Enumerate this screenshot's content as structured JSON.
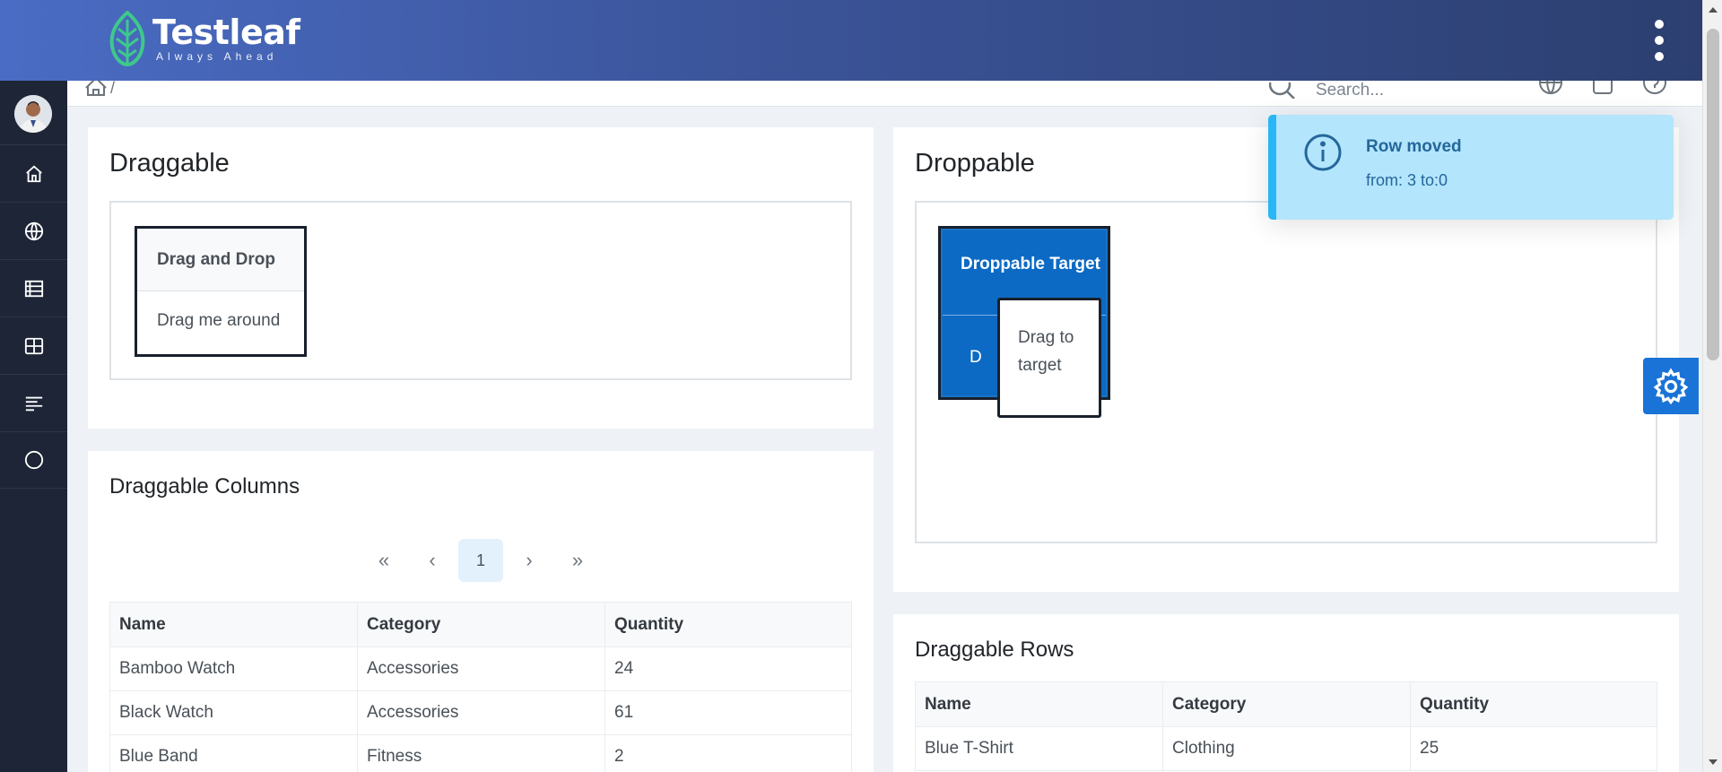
{
  "header": {
    "logo_name": "Testleaf",
    "logo_tagline": "Always Ahead"
  },
  "breadcrumb": {
    "separator": "/"
  },
  "search": {
    "placeholder": "Search..."
  },
  "sidebar": {
    "items": [
      {
        "icon": "home-icon"
      },
      {
        "icon": "globe-icon"
      },
      {
        "icon": "table-list-icon"
      },
      {
        "icon": "grid-icon"
      },
      {
        "icon": "align-left-icon"
      },
      {
        "icon": "circle-icon"
      }
    ]
  },
  "draggable": {
    "title": "Draggable",
    "panel_header": "Drag and Drop",
    "panel_body": "Drag me around"
  },
  "droppable": {
    "title": "Droppable",
    "target_header": "Droppable Target",
    "target_body": "D",
    "drag_item": "Drag to target"
  },
  "draggable_columns": {
    "title": "Draggable Columns",
    "paginator": {
      "first": "«",
      "prev": "‹",
      "page": "1",
      "next": "›",
      "last": "»"
    },
    "columns": [
      "Name",
      "Category",
      "Quantity"
    ],
    "rows": [
      [
        "Bamboo Watch",
        "Accessories",
        "24"
      ],
      [
        "Black Watch",
        "Accessories",
        "61"
      ],
      [
        "Blue Band",
        "Fitness",
        "2"
      ]
    ]
  },
  "draggable_rows": {
    "title": "Draggable Rows",
    "columns": [
      "Name",
      "Category",
      "Quantity"
    ],
    "rows": [
      [
        "Blue T-Shirt",
        "Clothing",
        "25"
      ]
    ]
  },
  "toast": {
    "title": "Row moved",
    "detail": "from: 3 to:0"
  },
  "colors": {
    "header_gradient_start": "#4a6cc4",
    "header_gradient_end": "#2c3f70",
    "sidebar": "#1e2536",
    "droppable_blue": "#0c6ac4",
    "toast_bg": "#b3e5fc",
    "toast_accent": "#29b6f6",
    "config_button": "#1a73d6"
  }
}
